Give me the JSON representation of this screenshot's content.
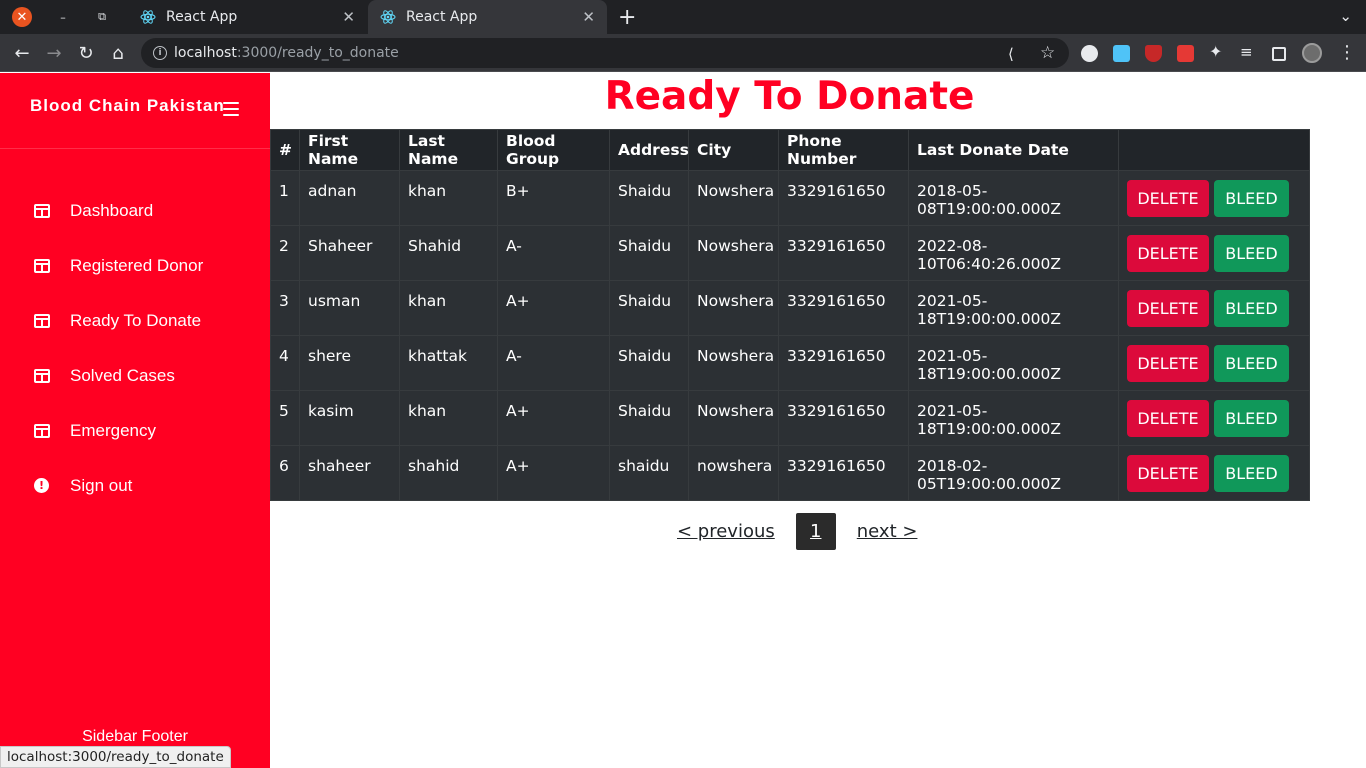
{
  "browser": {
    "tabs": [
      {
        "title": "React App"
      },
      {
        "title": "React App"
      }
    ],
    "url_host": "localhost",
    "url_rest": ":3000/ready_to_donate",
    "status_url": "localhost:3000/ready_to_donate"
  },
  "sidebar": {
    "brand": "Blood Chain Pakistan",
    "items": [
      {
        "label": "Dashboard",
        "icon": "table-icon"
      },
      {
        "label": "Registered Donor",
        "icon": "table-icon"
      },
      {
        "label": "Ready To Donate",
        "icon": "table-icon"
      },
      {
        "label": "Solved Cases",
        "icon": "table-icon"
      },
      {
        "label": "Emergency",
        "icon": "table-icon"
      },
      {
        "label": "Sign out",
        "icon": "alert-circle-icon"
      }
    ],
    "footer": "Sidebar Footer"
  },
  "main": {
    "title": "Ready To Donate",
    "table": {
      "headers": [
        "#",
        "First Name",
        "Last Name",
        "Blood Group",
        "Address",
        "City",
        "Phone Number",
        "Last Donate Date",
        ""
      ],
      "rows": [
        [
          "1",
          "adnan",
          "khan",
          "B+",
          "Shaidu",
          "Nowshera",
          "3329161650",
          "2018-05-08T19:00:00.000Z"
        ],
        [
          "2",
          "Shaheer",
          "Shahid",
          "A-",
          "Shaidu",
          "Nowshera",
          "3329161650",
          "2022-08-10T06:40:26.000Z"
        ],
        [
          "3",
          "usman",
          "khan",
          "A+",
          "Shaidu",
          "Nowshera",
          "3329161650",
          "2021-05-18T19:00:00.000Z"
        ],
        [
          "4",
          "shere",
          "khattak",
          "A-",
          "Shaidu",
          "Nowshera",
          "3329161650",
          "2021-05-18T19:00:00.000Z"
        ],
        [
          "5",
          "kasim",
          "khan",
          "A+",
          "Shaidu",
          "Nowshera",
          "3329161650",
          "2021-05-18T19:00:00.000Z"
        ],
        [
          "6",
          "shaheer",
          "shahid",
          "A+",
          "shaidu",
          "nowshera",
          "3329161650",
          "2018-02-05T19:00:00.000Z"
        ]
      ],
      "delete_label": "DELETE",
      "bleed_label": "BLEED"
    },
    "pagination": {
      "previous": "< previous",
      "current": "1",
      "next": "next >"
    }
  },
  "colors": {
    "sidebar_bg": "#ff0022",
    "title": "#ff0022",
    "table_bg": "#212529",
    "delete_btn": "#dc0a3b",
    "bleed_btn": "#10985a"
  }
}
